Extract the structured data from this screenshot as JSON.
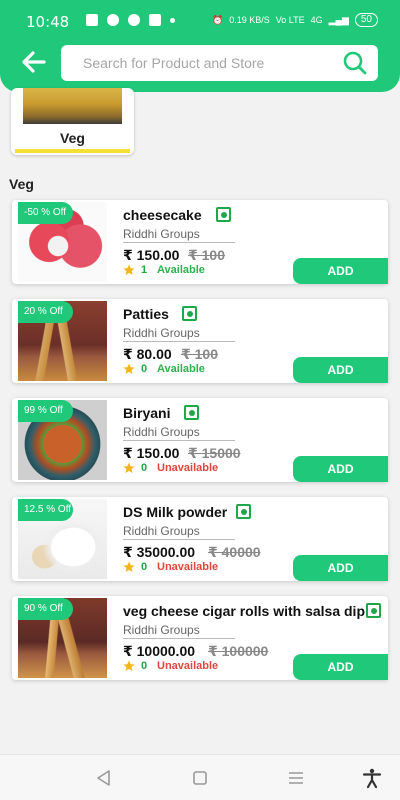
{
  "status_bar": {
    "time": "10:48",
    "net_speed": "0.19 KB/S",
    "network": "Vo LTE",
    "signal": "4G",
    "battery": "50"
  },
  "search": {
    "placeholder": "Search for Product and Store"
  },
  "category": {
    "label": "Veg"
  },
  "section": {
    "title": "Veg"
  },
  "colors": {
    "brand": "#20c979",
    "veg": "#1fa84a",
    "available": "#2db24d",
    "unavailable": "#e0473b"
  },
  "products": [
    {
      "name": "cheesecake",
      "store": "Riddhi Groups",
      "price": "₹ 150.00",
      "mrp": "₹ 100",
      "discount": "-50 % Off",
      "rating": "1",
      "availability": "Available",
      "add_label": "ADD"
    },
    {
      "name": "Patties",
      "store": "Riddhi Groups",
      "price": "₹ 80.00",
      "mrp": "₹ 100",
      "discount": "20 % Off",
      "rating": "0",
      "availability": "Available",
      "add_label": "ADD"
    },
    {
      "name": "Biryani",
      "store": "Riddhi Groups",
      "price": "₹ 150.00",
      "mrp": "₹ 15000",
      "discount": "99 % Off",
      "rating": "0",
      "availability": "Unavailable",
      "add_label": "ADD"
    },
    {
      "name": "DS Milk powder",
      "store": "Riddhi Groups",
      "price": "₹ 35000.00",
      "mrp": "₹ 40000",
      "discount": "12.5 % Off",
      "rating": "0",
      "availability": "Unavailable",
      "add_label": "ADD"
    },
    {
      "name": "veg cheese cigar rolls with salsa dip",
      "store": "Riddhi Groups",
      "price": "₹ 10000.00",
      "mrp": "₹ 100000",
      "discount": "90 % Off",
      "rating": "0",
      "availability": "Unavailable",
      "add_label": "ADD"
    }
  ],
  "icons": {
    "back": "arrow-left-icon",
    "search": "search-icon",
    "veg": "veg-indicator-icon",
    "star": "star-icon",
    "nav_back": "triangle-back-icon",
    "nav_home": "square-home-icon",
    "nav_menu": "menu-lines-icon",
    "accessibility": "accessibility-icon"
  }
}
